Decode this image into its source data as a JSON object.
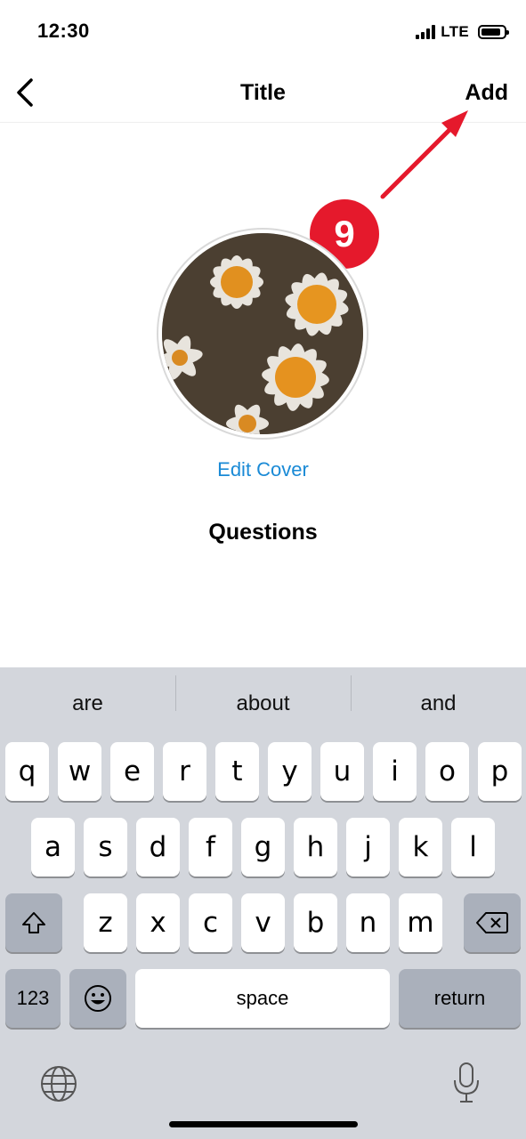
{
  "status_bar": {
    "time": "12:30",
    "network": "LTE"
  },
  "nav": {
    "back_icon": "chevron-left-icon",
    "title": "Title",
    "add_label": "Add"
  },
  "annotation": {
    "step_number": "9",
    "color": "#e5192c"
  },
  "cover": {
    "image": "daisy-flowers-photo",
    "edit_label": "Edit Cover"
  },
  "content": {
    "heading": "Questions"
  },
  "keyboard": {
    "suggestions": [
      "are",
      "about",
      "and"
    ],
    "row1": [
      "q",
      "w",
      "e",
      "r",
      "t",
      "y",
      "u",
      "i",
      "o",
      "p"
    ],
    "row2": [
      "a",
      "s",
      "d",
      "f",
      "g",
      "h",
      "j",
      "k",
      "l"
    ],
    "row3": [
      "z",
      "x",
      "c",
      "v",
      "b",
      "n",
      "m"
    ],
    "numbers_label": "123",
    "space_label": "space",
    "return_label": "return",
    "icons": [
      "shift-icon",
      "backspace-icon",
      "emoji-icon",
      "globe-icon",
      "microphone-icon"
    ]
  },
  "colors": {
    "accent_link": "#1a8ad6",
    "keyboard_bg": "#d3d6dc",
    "key_dark": "#aab0bb"
  }
}
